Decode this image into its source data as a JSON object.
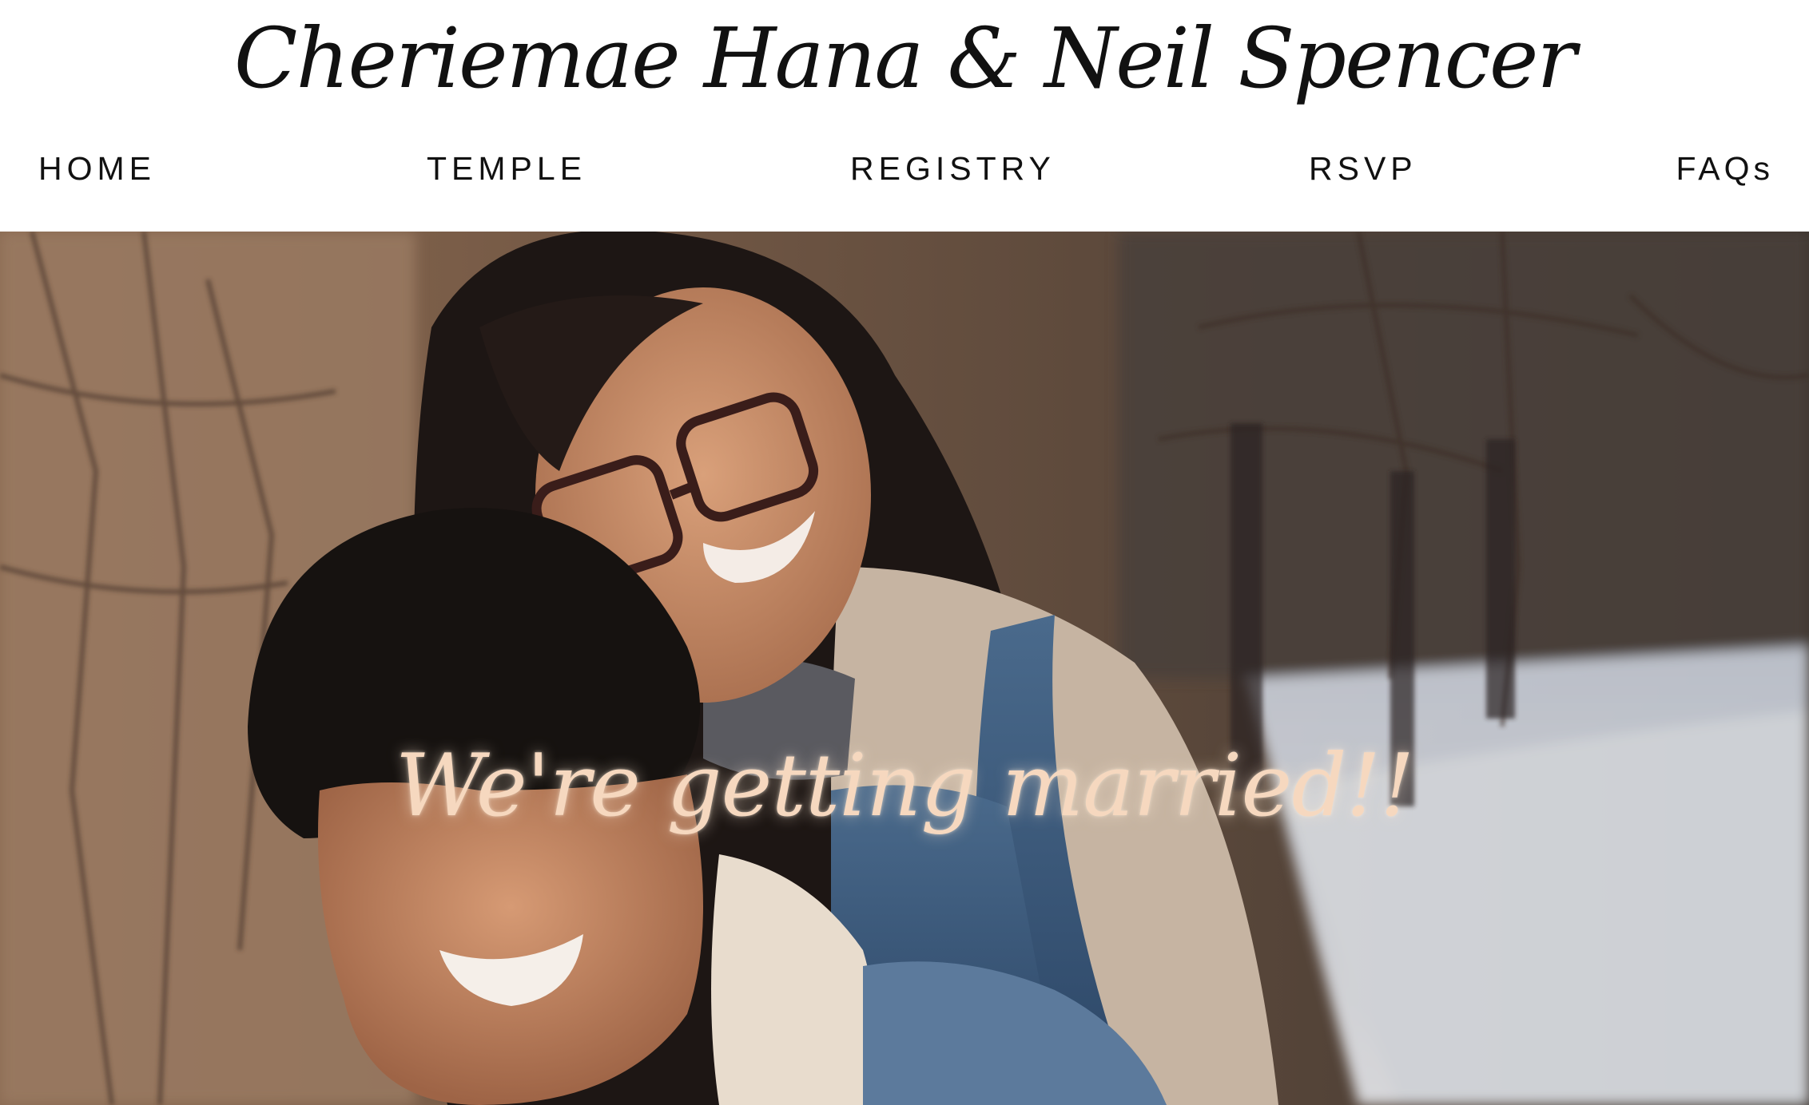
{
  "site": {
    "title": "Cheriemae Hana & Neil Spencer"
  },
  "nav": {
    "items": [
      {
        "label": "HOME"
      },
      {
        "label": "TEMPLE"
      },
      {
        "label": "REGISTRY"
      },
      {
        "label": "RSVP"
      },
      {
        "label": "FAQs"
      }
    ]
  },
  "hero": {
    "caption": "We're getting married!!",
    "caption_color": "#f6d8bf"
  }
}
